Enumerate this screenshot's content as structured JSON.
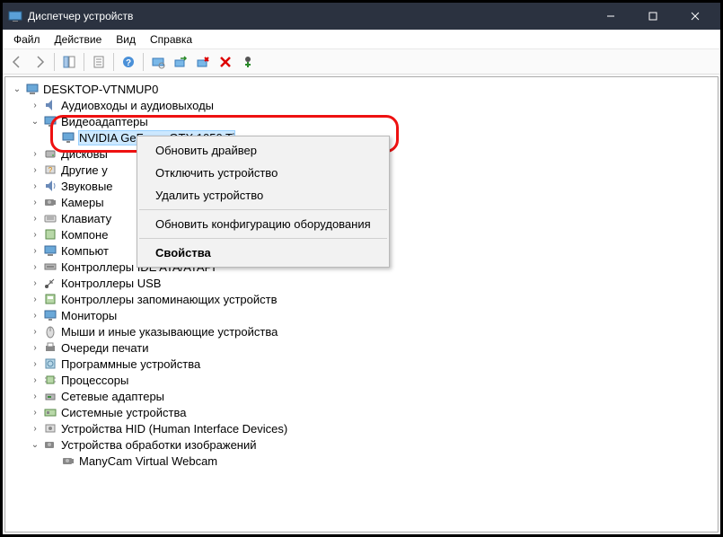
{
  "titlebar": {
    "title": "Диспетчер устройств"
  },
  "menubar": {
    "file": "Файл",
    "action": "Действие",
    "view": "Вид",
    "help": "Справка"
  },
  "tree": {
    "root": "DESKTOP-VTNMUP0",
    "selected_device": "NVIDIA GeForce GTX 1050 Ti",
    "categories": [
      {
        "label": "Аудиовходы и аудиовыходы",
        "icon": "audio"
      },
      {
        "label": "Видеоадаптеры",
        "icon": "display",
        "expanded": true
      },
      {
        "label": "Дисковы",
        "icon": "disk",
        "cut": true
      },
      {
        "label": "Другие у",
        "icon": "other",
        "cut": true
      },
      {
        "label": "Звуковые",
        "icon": "sound",
        "cut": true
      },
      {
        "label": "Камеры",
        "icon": "camera",
        "cut": true
      },
      {
        "label": "Клавиату",
        "icon": "keyboard",
        "cut": true
      },
      {
        "label": "Компоне",
        "icon": "comp",
        "cut": true
      },
      {
        "label": "Компьют",
        "icon": "pc",
        "cut": true
      },
      {
        "label": "Контроллеры IDE ATA/ATAPI",
        "icon": "ide"
      },
      {
        "label": "Контроллеры USB",
        "icon": "usb"
      },
      {
        "label": "Контроллеры запоминающих устройств",
        "icon": "storage"
      },
      {
        "label": "Мониторы",
        "icon": "monitor"
      },
      {
        "label": "Мыши и иные указывающие устройства",
        "icon": "mouse"
      },
      {
        "label": "Очереди печати",
        "icon": "print"
      },
      {
        "label": "Программные устройства",
        "icon": "soft"
      },
      {
        "label": "Процессоры",
        "icon": "cpu"
      },
      {
        "label": "Сетевые адаптеры",
        "icon": "net"
      },
      {
        "label": "Системные устройства",
        "icon": "sys"
      },
      {
        "label": "Устройства HID (Human Interface Devices)",
        "icon": "hid"
      },
      {
        "label": "Устройства обработки изображений",
        "icon": "img",
        "expanded": true,
        "child": "ManyCam Virtual Webcam"
      }
    ]
  },
  "context_menu": {
    "update_driver": "Обновить драйвер",
    "disable": "Отключить устройство",
    "uninstall": "Удалить устройство",
    "scan": "Обновить конфигурацию оборудования",
    "properties": "Свойства"
  }
}
